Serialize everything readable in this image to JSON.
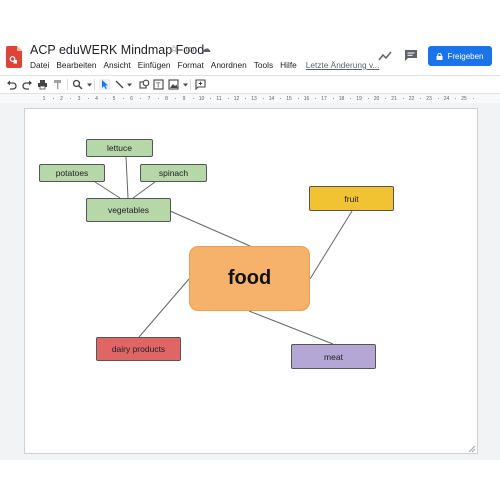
{
  "header": {
    "title": "ACP eduWERK Mindmap Food",
    "menu": [
      "Datei",
      "Bearbeiten",
      "Ansicht",
      "Einfügen",
      "Format",
      "Anordnen",
      "Tools",
      "Hilfe"
    ],
    "last_edit": "Letzte Änderung v...",
    "share_label": "Freigeben"
  },
  "ruler": {
    "ticks": [
      "1",
      "2",
      "3",
      "4",
      "5",
      "6",
      "7",
      "8",
      "9",
      "10",
      "11",
      "12",
      "13",
      "14",
      "15",
      "16",
      "17",
      "18",
      "19",
      "20",
      "21",
      "22",
      "23",
      "24",
      "25"
    ]
  },
  "mindmap": {
    "nodes": {
      "food": {
        "label": "food",
        "color": "#f6b26b"
      },
      "vegetables": {
        "label": "vegetables",
        "color": "#b6d7a8"
      },
      "lettuce": {
        "label": "lettuce",
        "color": "#b6d7a8"
      },
      "potatoes": {
        "label": "potatoes",
        "color": "#b6d7a8"
      },
      "spinach": {
        "label": "spinach",
        "color": "#b6d7a8"
      },
      "fruit": {
        "label": "fruit",
        "color": "#f1c232"
      },
      "dairy": {
        "label": "dairy products",
        "color": "#e06666"
      },
      "meat": {
        "label": "meat",
        "color": "#b4a7d6"
      }
    }
  },
  "colors": {
    "accent": "#1a73e8"
  }
}
